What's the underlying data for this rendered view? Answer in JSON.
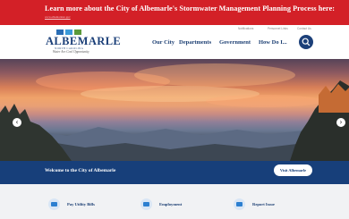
{
  "alert": {
    "text": "Learn more about the City of Albemarle's Stormwater Management Planning Process here:",
    "link": "www.albemarlenc.gov"
  },
  "logo": {
    "name": "ALBEMARLE",
    "state": "NORTH CAROLINA",
    "tagline": "Water Are Cool Opportunity",
    "colors": [
      "#2a6db5",
      "#3b9ad9",
      "#5b9a3a"
    ]
  },
  "utility": [
    "Notifications",
    "Personnel Links",
    "Contact Us"
  ],
  "nav": [
    "Our City",
    "Departments",
    "Government",
    "How Do I..."
  ],
  "hero": {
    "welcome": "Welcome to the City of Albemarle",
    "button": "Visit Albemarle"
  },
  "quick_links": [
    "Pay Utility Bills",
    "Employment",
    "Report Issue"
  ],
  "colors": {
    "alert_red": "#d32027",
    "navy": "#173f7a",
    "accent_blue": "#2c7fd0"
  }
}
